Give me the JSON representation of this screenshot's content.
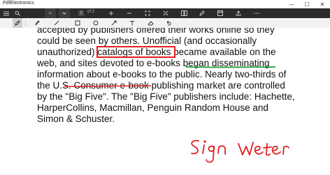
{
  "app": {
    "title": "PdfElectronics"
  },
  "window": {
    "minimize": "—",
    "maximize": "☐",
    "close": "✕"
  },
  "toolbar": {
    "current_page": "1",
    "total_pages": "of 2",
    "icons": [
      "hamburger-icon",
      "search-icon",
      "previous-icon",
      "page-icon",
      "zoom-in-icon",
      "zoom-out-icon",
      "fit-icon",
      "fullscreen-icon",
      "two-page-icon",
      "ink-icon",
      "save-icon",
      "share-icon",
      "more-icon"
    ]
  },
  "ink_tools": {
    "icons": [
      "pen-icon",
      "highlighter-icon",
      "line-icon",
      "rectangle-icon",
      "ellipse-icon",
      "arrow-icon",
      "text-icon",
      "eraser-icon",
      "undo-icon"
    ]
  },
  "document": {
    "lines": [
      "accepted by publishers offered their works online so they",
      "could be seen by others. Unofficial (and occasionally",
      "unauthorized) catalogs of books became available on the",
      "web, and sites devoted to e-books began disseminating",
      "information about e-books to the public. Nearly two-thirds of",
      "the U.S. Consumer e-book publishing market are controlled",
      "by the \"Big Five\". The \"Big Five\" publishers include: Hachette,",
      "HarperCollins, Macmillan, Penguin Random House and",
      "Simon & Schuster."
    ]
  },
  "annotations": {
    "colors": {
      "box": "#e02020",
      "underline": "#1f9d3a",
      "strikethrough": "#e02020",
      "ink": "#e02020"
    },
    "handwriting": [
      "Sign",
      "Weter"
    ]
  }
}
